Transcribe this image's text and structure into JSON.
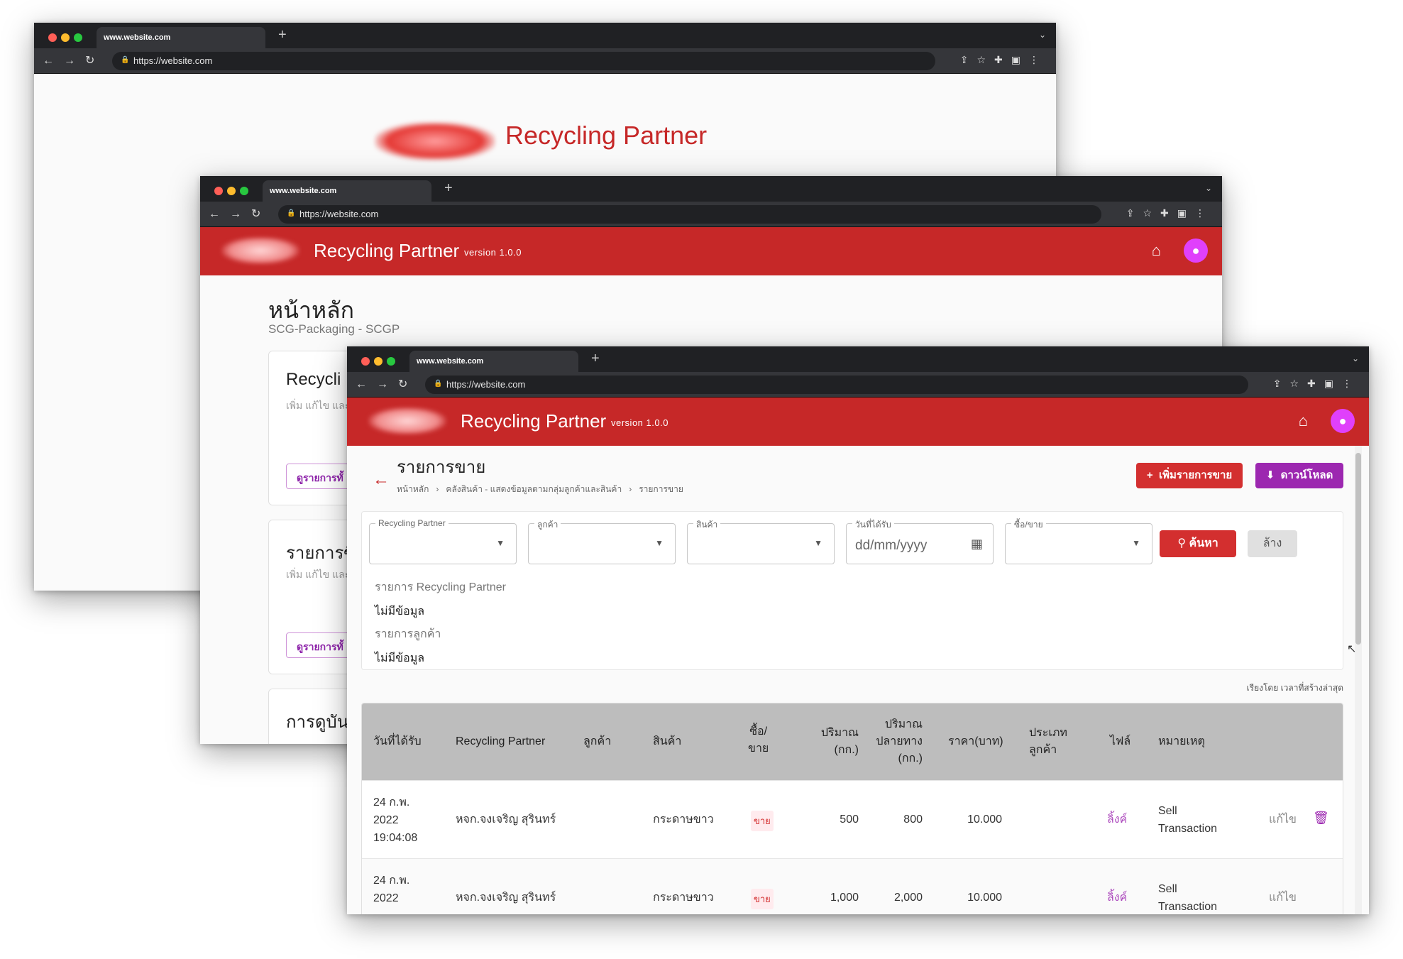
{
  "browser": {
    "tab_title": "www.website.com",
    "url": "https://website.com",
    "new_tab": "+",
    "tab_chevron": "⌄"
  },
  "app": {
    "title": "Recycling Partner",
    "version": "version 1.0.0",
    "brand_color": "#c62828",
    "accent_color": "#9c27b0"
  },
  "window1": {
    "title": "Recycling Partner"
  },
  "window2": {
    "page_title": "หน้าหลัก",
    "subtitle": "SCG-Packaging - SCGP",
    "cards": [
      {
        "title": "Recycli",
        "subtitle": "เพิ่ม แก้ไข และ",
        "button": "ดูรายการทั้"
      },
      {
        "title": "รายการซื",
        "subtitle": "เพิ่ม แก้ไข และ",
        "button": "ดูรายการทั้"
      },
      {
        "title": "การดูบัน"
      }
    ]
  },
  "sales": {
    "page_title": "รายการขาย",
    "breadcrumb": [
      "หน้าหลัก",
      "คลังสินค้า - แสดงข้อมูลตามกลุ่มลูกค้าและสินค้า",
      "รายการขาย"
    ],
    "add_button": "เพิ่มรายการขาย",
    "download_button": "ดาวน์โหลด",
    "filters": {
      "partner_label": "Recycling Partner",
      "customer_label": "ลูกค้า",
      "product_label": "สินค้า",
      "date_label": "วันที่ได้รับ",
      "date_placeholder": "dd/mm/yyyy",
      "buysell_label": "ซื้อ/ขาย",
      "search_button": "ค้นหา",
      "clear_button": "ล้าง"
    },
    "info": {
      "partner_list_label": "รายการ Recycling Partner",
      "partner_list_value": "ไม่มีข้อมูล",
      "customer_list_label": "รายการลูกค้า",
      "customer_list_value": "ไม่มีข้อมูล"
    },
    "sort": "เรียงโดย  เวลาที่สร้างล่าสุด",
    "columns": {
      "date": "วันที่ได้รับ",
      "partner": "Recycling Partner",
      "customer": "ลูกค้า",
      "product": "สินค้า",
      "buysell_1": "ซื้อ/",
      "buysell_2": "ขาย",
      "qty_1": "ปริมาณ",
      "qty_2": "(กก.)",
      "dest_1": "ปริมาณ",
      "dest_2": "ปลายทาง",
      "dest_3": "(กก.)",
      "price": "ราคา(บาท)",
      "custtype_1": "ประเภท",
      "custtype_2": "ลูกค้า",
      "file": "ไฟล์",
      "note": "หมายเหตุ"
    },
    "rows": [
      {
        "date_1": "24 ก.พ.",
        "date_2": "2022",
        "date_3": "19:04:08",
        "partner": "หจก.จงเจริญ สุรินทร์",
        "product": "กระดาษขาว",
        "type": "ขาย",
        "qty": "500",
        "dest_qty": "800",
        "price": "10.000",
        "file": "ลิ้งค์",
        "note_1": "Sell",
        "note_2": "Transaction",
        "edit": "แก้ไข"
      },
      {
        "date_1": "24 ก.พ.",
        "date_2": "2022",
        "date_3": "",
        "partner": "หจก.จงเจริญ สุรินทร์",
        "product": "กระดาษขาว",
        "type": "ขาย",
        "qty": "1,000",
        "dest_qty": "2,000",
        "price": "10.000",
        "file": "ลิ้งค์",
        "note_1": "Sell",
        "note_2": "Transaction",
        "edit": "แก้ไข"
      }
    ]
  }
}
